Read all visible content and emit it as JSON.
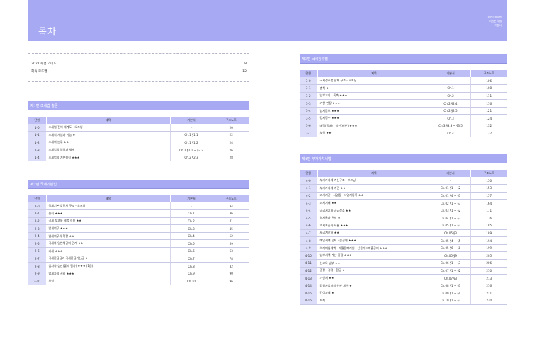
{
  "header": {
    "title": "목차",
    "right_lines": [
      "해커스공무원",
      "이현준 세법",
      "기본서"
    ]
  },
  "guide": [
    {
      "label": "2027 수험 가이드",
      "page": "8"
    },
    {
      "label": "회독 로드맵",
      "page": "12"
    }
  ],
  "columns": {
    "unit": "단원",
    "title": "제목",
    "source": "기본서",
    "note": "구조노트"
  },
  "sections": [
    {
      "heading": "제1편  조세법 총론",
      "rows": [
        {
          "unit": "1-0",
          "title": "조세법 전체 체계도 - 오프닝",
          "source": "-",
          "page": "20"
        },
        {
          "unit": "1-1",
          "title": "조세의 개념과 기능 ★",
          "source": "Ch.1 §1.1",
          "page": "22"
        },
        {
          "unit": "1-2",
          "title": "조세의 분류 ★★",
          "source": "Ch.1 §1.2",
          "page": "24"
        },
        {
          "unit": "1-3",
          "title": "조세법의 법원과 체계",
          "source": "Ch.2 §2.1 ~ §2.2",
          "page": "26"
        },
        {
          "unit": "1-4",
          "title": "조세법의 기본원칙 ★★★",
          "source": "Ch.2 §2.3",
          "page": "28"
        }
      ]
    },
    {
      "heading": "제2편  국세기본법",
      "rows": [
        {
          "unit": "2-0",
          "title": "국세기본법 전체 구조 - 오프닝",
          "source": "-",
          "page": "34"
        },
        {
          "unit": "2-1",
          "title": "총칙 ★★★",
          "source": "Ch.1",
          "page": "36"
        },
        {
          "unit": "2-2",
          "title": "국세 부과와 세법 적용 ★★",
          "source": "Ch.2",
          "page": "41"
        },
        {
          "unit": "2-3",
          "title": "납세의무 ★★★",
          "source": "Ch.3",
          "page": "45"
        },
        {
          "unit": "2-4",
          "title": "납세의무의 확장 ★★",
          "source": "Ch.4",
          "page": "52"
        },
        {
          "unit": "2-5",
          "title": "국세와 일반채권의 관계 ★★",
          "source": "Ch.5",
          "page": "59"
        },
        {
          "unit": "2-6",
          "title": "과세 ★★★",
          "source": "Ch.6",
          "page": "63"
        },
        {
          "unit": "2-7",
          "title": "국세환급금과 국세환급가산금 ★",
          "source": "Ch.7",
          "page": "78"
        },
        {
          "unit": "2-8",
          "title": "심사와 심판(불복 절차) ★★★ (1급)",
          "source": "Ch.8",
          "page": "82"
        },
        {
          "unit": "2-9",
          "title": "납세자의 권리 ★★★",
          "source": "Ch.9",
          "page": "90"
        },
        {
          "unit": "2-10",
          "title": "보칙",
          "source": "Ch.10",
          "page": "96"
        }
      ]
    },
    {
      "heading": "제3편  국세징수법",
      "rows": [
        {
          "unit": "3-0",
          "title": "국세징수법 전체 구조 - 오프닝",
          "source": "-",
          "page": "106"
        },
        {
          "unit": "3-1",
          "title": "총칙 ★",
          "source": "Ch.1",
          "page": "108"
        },
        {
          "unit": "3-2",
          "title": "납부고지 · 독촉 ★★★",
          "source": "Ch.2",
          "page": "111"
        },
        {
          "unit": "3-3",
          "title": "기한 연장 ★★★",
          "source": "Ch.2 §2.4",
          "page": "116"
        },
        {
          "unit": "3-4",
          "title": "납세담보 ★★★",
          "source": "Ch.2 §2.5",
          "page": "121"
        },
        {
          "unit": "3-5",
          "title": "강제징수 ★★★",
          "source": "Ch.3",
          "page": "124"
        },
        {
          "unit": "3-6",
          "title": "매각(공매) · 청산(배분) ★★★",
          "source": "Ch.3 §3.3 ~ §3.5",
          "page": "132"
        },
        {
          "unit": "3-7",
          "title": "보칙 ★★",
          "source": "Ch.4",
          "page": "137"
        }
      ]
    },
    {
      "heading": "제4편  부가가치세법",
      "rows": [
        {
          "unit": "4-0",
          "title": "부가가치세 계산구조 - 오프닝",
          "source": "-",
          "page": "150"
        },
        {
          "unit": "4-1",
          "title": "부가가치세 개관 ★★",
          "source": "Ch.01 §1 ~ §2",
          "page": "153"
        },
        {
          "unit": "4-2",
          "title": "과세기간 · 사업장 · 사업자등록 ★★",
          "source": "Ch.01 §4 ~ §7",
          "page": "157"
        },
        {
          "unit": "4-3",
          "title": "과세거래 ★★",
          "source": "Ch.02 §1 ~ §3",
          "page": "164"
        },
        {
          "unit": "4-4",
          "title": "공급시기와 공급장소 ★★",
          "source": "Ch.03 §1 ~ §2",
          "page": "171"
        },
        {
          "unit": "4-5",
          "title": "영세율과 면세 ★",
          "source": "Ch.04 §1 ~ §3",
          "page": "176"
        },
        {
          "unit": "4-6",
          "title": "과세표준과 세율 ★★★",
          "source": "Ch.05 §1 ~ §2",
          "page": "185"
        },
        {
          "unit": "4-7",
          "title": "세금계산서 ★★",
          "source": "Ch.05 §3",
          "page": "189"
        },
        {
          "unit": "4-8",
          "title": "매입세액 공제 · 불공제 ★★★",
          "source": "Ch.05 §4 ~ §5",
          "page": "194"
        },
        {
          "unit": "4-9",
          "title": "의제매입세액 · 재활용폐자원 · 신용카드매출공제 ★★★",
          "source": "Ch.05 §6 ~ §8",
          "page": "199"
        },
        {
          "unit": "4-10",
          "title": "납부세액 계산 종합 ★★★",
          "source": "Ch.05 §9",
          "page": "205"
        },
        {
          "unit": "4-11",
          "title": "신고와 납부 ★★",
          "source": "Ch.06 §1 ~ §3",
          "page": "206"
        },
        {
          "unit": "4-12",
          "title": "결정 · 경정 · 환급 ★",
          "source": "Ch.07 §1 ~ §2",
          "page": "210"
        },
        {
          "unit": "4-13",
          "title": "가산세 ★★",
          "source": "Ch.07 §3",
          "page": "213"
        },
        {
          "unit": "4-14",
          "title": "겸영사업자의 안분 계산 ★",
          "source": "Ch.08 §1 ~ §3",
          "page": "216"
        },
        {
          "unit": "4-15",
          "title": "간이과세 ★",
          "source": "Ch.09 §1 ~ §4",
          "page": "221"
        },
        {
          "unit": "4-16",
          "title": "보칙",
          "source": "Ch.10 §1 ~ §2",
          "page": "230"
        }
      ]
    }
  ]
}
